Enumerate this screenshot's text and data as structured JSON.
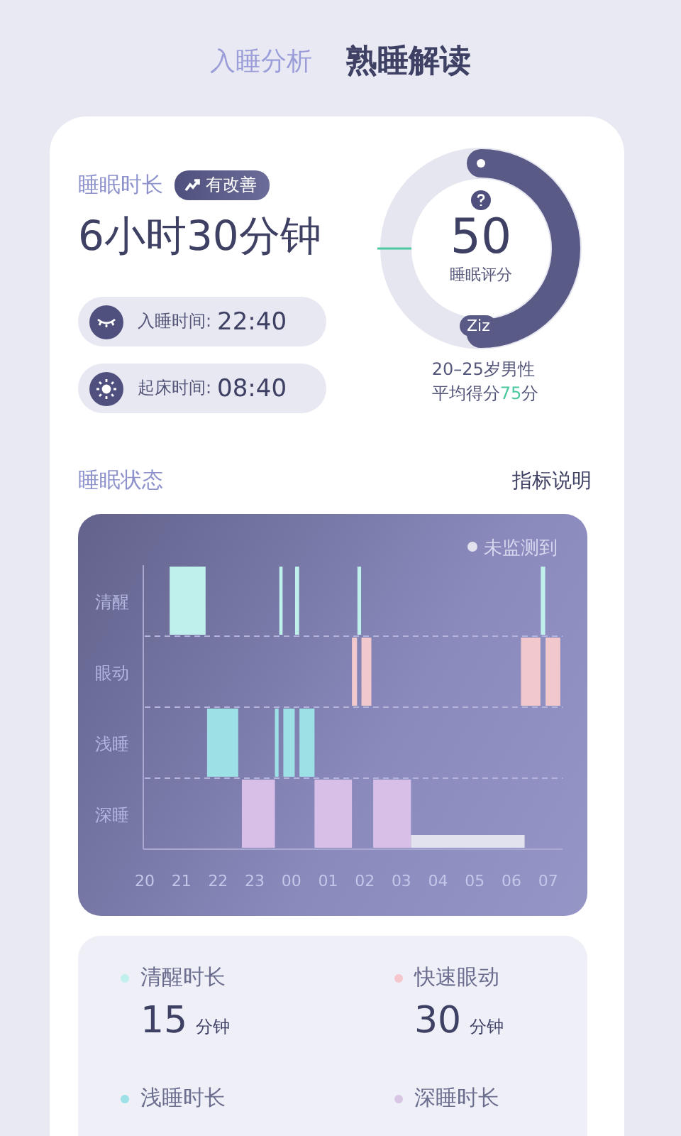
{
  "tabs": [
    {
      "label": "入睡分析",
      "selected": false
    },
    {
      "label": "熟睡解读",
      "selected": true
    }
  ],
  "summary": {
    "label": "睡眠时长",
    "badge": "有改善",
    "duration": "6小时30分钟",
    "times": [
      {
        "kind": "sleep",
        "label": "入睡时间:",
        "value": "22:40"
      },
      {
        "kind": "wake",
        "label": "起床时间:",
        "value": "08:40"
      }
    ]
  },
  "score": {
    "value": "50",
    "label": "睡眠评分",
    "level": 0.5,
    "mark": "Ziz",
    "group": "20–25岁男性",
    "average": "平均得分**75**分"
  },
  "status": {
    "title": "睡眠状态",
    "link": "指标说明",
    "legend": {
      "label": "未监测到",
      "color": "#e2e2ee"
    },
    "stages": [
      "清醒",
      "眼动",
      "浅睡",
      "深睡"
    ],
    "hours": [
      "20",
      "21",
      "22",
      "23",
      "00",
      "01",
      "02",
      "03",
      "04",
      "05",
      "06",
      "07"
    ]
  },
  "stats": [
    {
      "name": "清醒时长",
      "value": "15",
      "unit": "分钟",
      "color": "#bff0ec"
    },
    {
      "name": "快速眼动",
      "value": "30",
      "unit": "分钟",
      "color": "#f5c6cc"
    },
    {
      "name": "浅睡时长",
      "color": "#9de0e6"
    },
    {
      "name": "深睡时长",
      "color": "#d8c6e4"
    }
  ]
}
